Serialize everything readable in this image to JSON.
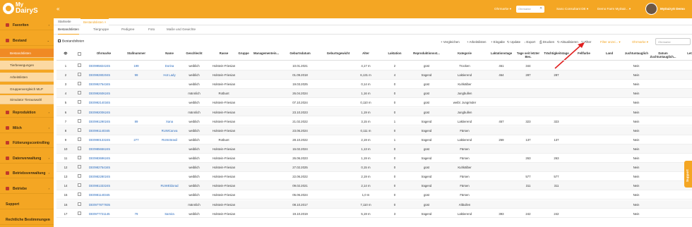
{
  "app": {
    "logo_top": "My",
    "logo_bottom": "DairyS",
    "collapse_icon": "«"
  },
  "topbar": {
    "sort_label": "Ohrmarke ▾",
    "search_placeholder": "Ohrmarke",
    "user_company": "Sano Consultant DE ▾",
    "farm": "Demo Farm MyDair... ▾",
    "user_name": "MyDairyS Demo"
  },
  "sidebar": {
    "groups": [
      {
        "label": "Favoriten",
        "icon": "star-icon"
      },
      {
        "label": "Bestand",
        "icon": "cow-icon"
      },
      {
        "label": "Reproduktion",
        "icon": "heart-icon"
      },
      {
        "label": "Milch",
        "icon": "milk-icon"
      },
      {
        "label": "Fütterungscontrolling",
        "icon": "feed-icon"
      },
      {
        "label": "Datenverwaltung",
        "icon": "database-icon"
      },
      {
        "label": "Betriebsverwaltung",
        "icon": "building-icon"
      },
      {
        "label": "Betriebe",
        "icon": "farm-icon"
      },
      {
        "label": "Support",
        "icon": ""
      },
      {
        "label": "Rechtliche Bestimmungen",
        "icon": ""
      }
    ],
    "subitems": [
      "Bestandslisten",
      "Tierbewegungen",
      "Arbeitslisten",
      "Gruppenvergleich MLP",
      "Simulator Tierauswahl"
    ]
  },
  "tabs": [
    "Startseite",
    "Bestandslisten ×"
  ],
  "subtabs": [
    "Bestandslisten",
    "Tiergruppe",
    "Pedigree",
    "Foto",
    "Maße und Gewichte"
  ],
  "section_title": "Bestandslisten",
  "toolbar": {
    "items": [
      "+ Vergleichen",
      "+ Arbeitslisten",
      "+ Eingabe",
      "↻ Update",
      "↓ Export",
      "⎙ Drucken",
      "↻ Aktualisieren",
      "▽ Filter"
    ],
    "filter_active": "Filter anzei... ▾",
    "sort": "Ohrmarke ▾",
    "search_placeholder": "Ohrmarke"
  },
  "table": {
    "headers": [
      "👁",
      "",
      "Ohrmarke",
      "Stallnummer",
      "Name",
      "Geschlecht",
      "Rasse",
      "Gruppe",
      "Managementein...",
      "Geburtsdatum",
      "Geburtsgewicht",
      "Alter",
      "Laktation",
      "Reproduktionsst...",
      "Kategorie",
      "Laktationstage",
      "Tage seit letzter Bes.",
      "Trächtigkeitstage",
      "Fellfarbe",
      "Land",
      "zuchtuntauglich",
      "Datum Zuchtuntauglich...",
      "Letzt..."
    ],
    "rows": [
      [
        "1",
        "DE0995824245",
        "199",
        "Dorina",
        "weiblich",
        "Holstein-Friesian",
        "",
        "",
        "10.01.2021",
        "",
        "4,17 m",
        "2",
        "güst",
        "Trocken",
        "461",
        "344",
        "",
        "",
        "",
        "Nein",
        ""
      ],
      [
        "2",
        "DE0992802045",
        "99",
        "Hot Lady",
        "weiblich",
        "Holstein-Friesian",
        "",
        "",
        "01.09.2018",
        "",
        "6,131 m",
        "4",
        "tragend",
        "Laktierend",
        "464",
        "287",
        "287",
        "",
        "",
        "Nein",
        ""
      ],
      [
        "3",
        "DE0992754345",
        "",
        "",
        "weiblich",
        "Holstein-Friesian",
        "",
        "",
        "19.03.2025",
        "",
        "0,14 m",
        "0",
        "güst",
        "Kuhkälber",
        "",
        "",
        "",
        "",
        "",
        "Nein",
        ""
      ],
      [
        "4",
        "DE0992606245",
        "",
        "",
        "männlich",
        "Rotbunt",
        "",
        "",
        "26.04.2024",
        "",
        "1,16 m",
        "0",
        "güst",
        "Jungbullen",
        "",
        "",
        "",
        "",
        "",
        "Nein",
        ""
      ],
      [
        "5",
        "DE0992140345",
        "",
        "",
        "weiblich",
        "Holstein-Friesian",
        "",
        "",
        "07.10.2024",
        "",
        "0,110 m",
        "0",
        "güst",
        "weibl. Jungrinder",
        "",
        "",
        "",
        "",
        "",
        "Nein",
        ""
      ],
      [
        "6",
        "DE0992006245",
        "",
        "",
        "männlich",
        "Holstein-Friesian",
        "",
        "",
        "23.10.2023",
        "",
        "1,19 m",
        "0",
        "güst",
        "Jungbullen",
        "",
        "",
        "",
        "",
        "",
        "Nein",
        ""
      ],
      [
        "7",
        "DE0991290245",
        "89",
        "Xana",
        "weiblich",
        "Holstein-Friesian",
        "",
        "",
        "21.02.2022",
        "",
        "3,15 m",
        "1",
        "tragend",
        "Laktierend",
        "457",
        "323",
        "323",
        "",
        "",
        "Nein",
        ""
      ],
      [
        "8",
        "DE0991140345",
        "",
        "RUWCanva",
        "weiblich",
        "Holstein-Friesian",
        "",
        "",
        "23.06.2024",
        "",
        "0,111 m",
        "0",
        "tragend",
        "Färsen",
        "",
        "",
        "",
        "",
        "",
        "Nein",
        ""
      ],
      [
        "9",
        "DE0990133245",
        "277",
        "RUW.Brasil",
        "weiblich",
        "Rotbunt",
        "",
        "",
        "28.10.2022",
        "",
        "2,19 m",
        "1",
        "tragend",
        "Laktierend",
        "259",
        "137",
        "137",
        "",
        "",
        "Nein",
        ""
      ],
      [
        "10",
        "DE0985656245",
        "",
        "",
        "weiblich",
        "Holstein-Friesian",
        "",
        "",
        "15.02.2024",
        "",
        "1,13 m",
        "0",
        "güst",
        "Färsen",
        "",
        "",
        "",
        "",
        "",
        "Nein",
        ""
      ],
      [
        "11",
        "DE0983696245",
        "",
        "",
        "weiblich",
        "Holstein-Friesian",
        "",
        "",
        "26.06.2023",
        "",
        "1,19 m",
        "0",
        "tragend",
        "Färsen",
        "",
        "263",
        "263",
        "",
        "",
        "Nein",
        ""
      ],
      [
        "12",
        "DE0982754345",
        "",
        "",
        "weiblich",
        "Holstein-Friesian",
        "",
        "",
        "27.02.2025",
        "",
        "0,15 m",
        "0",
        "güst",
        "Kuhkälber",
        "",
        "",
        "",
        "",
        "",
        "Nein",
        ""
      ],
      [
        "13",
        "DE0982280245",
        "",
        "",
        "weiblich",
        "Holstein-Friesian",
        "",
        "",
        "22.06.2022",
        "",
        "2,19 m",
        "0",
        "tragend",
        "Färsen",
        "",
        "577",
        "577",
        "",
        "",
        "Nein",
        ""
      ],
      [
        "14",
        "DE0981333245",
        "",
        "RUWEldorad",
        "weiblich",
        "Holstein-Friesian",
        "",
        "",
        "09.02.2021",
        "",
        "2,14 m",
        "0",
        "tragend",
        "Färsen",
        "",
        "311",
        "311",
        "",
        "",
        "Nein",
        ""
      ],
      [
        "15",
        "DE0981140345",
        "",
        "",
        "weiblich",
        "Holstein-Friesian",
        "",
        "",
        "05.06.2024",
        "",
        "1,0 m",
        "0",
        "güst",
        "Färsen",
        "",
        "",
        "",
        "",
        "",
        "Nein",
        ""
      ],
      [
        "16",
        "DE0977877935",
        "",
        "",
        "männlich",
        "Holstein-Friesian",
        "",
        "",
        "08.10.2017",
        "",
        "7,110 m",
        "0",
        "güst",
        "Altbullen",
        "",
        "",
        "",
        "",
        "",
        "Nein",
        ""
      ],
      [
        "17",
        "DE0977721145",
        "79",
        "Samira",
        "weiblich",
        "Holstein-Friesian",
        "",
        "",
        "19.10.2019",
        "",
        "5,19 m",
        "3",
        "tragend",
        "Laktierend",
        "393",
        "242",
        "242",
        "",
        "",
        "Nein",
        ""
      ]
    ]
  },
  "support_tab": "Support"
}
